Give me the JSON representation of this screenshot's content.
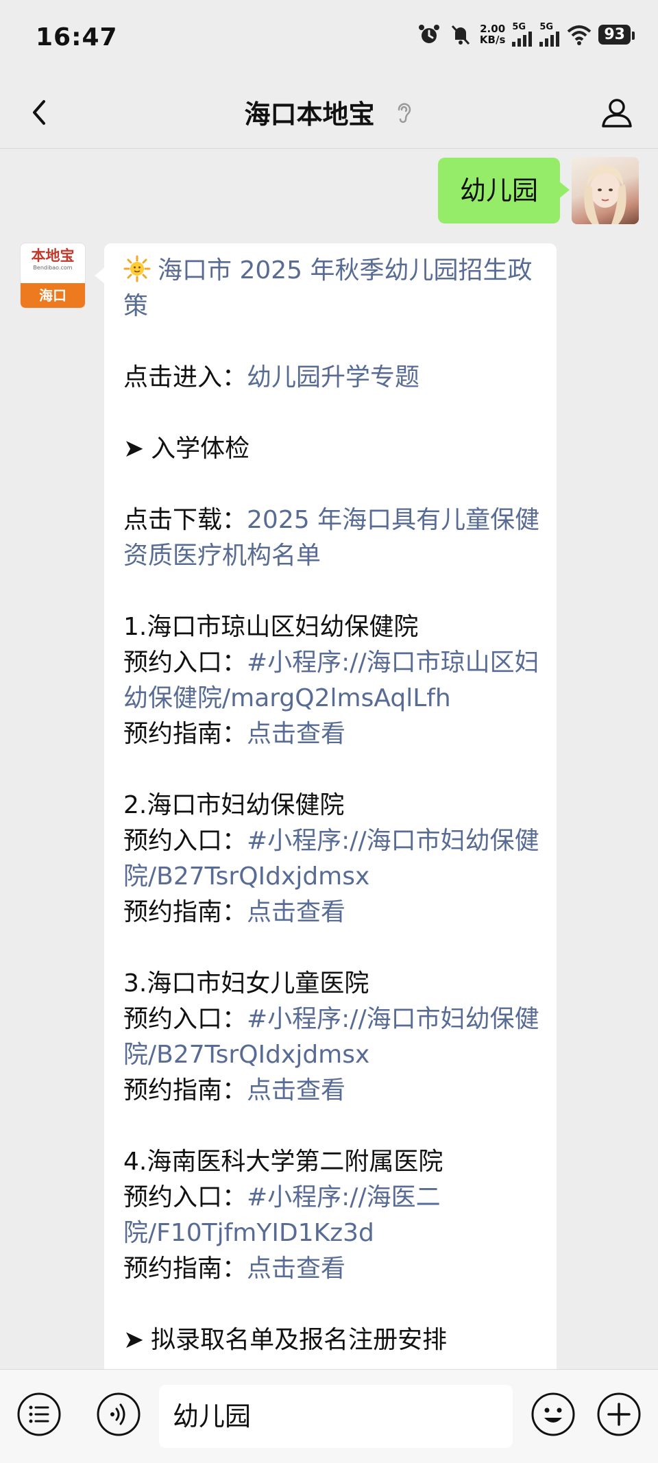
{
  "status_bar": {
    "time": "16:47",
    "net_speed_value": "2.00",
    "net_speed_unit": "KB/s",
    "sim1_label": "5G",
    "sim2_label": "5G",
    "battery": "93",
    "icons": [
      "alarm-icon",
      "mute-bell-icon",
      "signal-icon",
      "signal-icon",
      "wifi-icon",
      "battery-icon"
    ]
  },
  "nav": {
    "title": "海口本地宝",
    "icons": [
      "back-icon",
      "ear-icon",
      "profile-icon"
    ]
  },
  "chat": {
    "my_message": "幼儿园",
    "bot_avatar": {
      "logo_text": "本地宝",
      "logo_sub": "Bendibao.com",
      "city": "海口"
    },
    "bot_message": {
      "title": "海口市 2025 年秋季幼儿园招生政策",
      "enter_label": "点击进入：",
      "enter_link": "幼儿园升学专题",
      "section1": "入学体检",
      "download_label": "点击下载：",
      "download_link": "2025 年海口具有儿童保健资质医疗机构名单",
      "hospitals": [
        {
          "name": "1.海口市琼山区妇幼保健院",
          "entry_label": "预约入口：",
          "entry_link": "#小程序://海口市琼山区妇幼保健院/margQ2lmsAqlLfh",
          "guide_label": "预约指南：",
          "guide_link": "点击查看"
        },
        {
          "name": "2.海口市妇幼保健院",
          "entry_label": "预约入口：",
          "entry_link": "#小程序://海口市妇幼保健院/B27TsrQIdxjdmsx",
          "guide_label": "预约指南：",
          "guide_link": "点击查看"
        },
        {
          "name": "3.海口市妇女儿童医院",
          "entry_label": "预约入口：",
          "entry_link": "#小程序://海口市妇幼保健院/B27TsrQIdxjdmsx",
          "guide_label": "预约指南：",
          "guide_link": "点击查看"
        },
        {
          "name": "4.海南医科大学第二附属医院",
          "entry_label": "预约入口：",
          "entry_link": "#小程序://海医二院/F10TjfmYID1Kz3d",
          "guide_label": "预约指南：",
          "guide_link": "点击查看"
        }
      ],
      "section2": "拟录取名单及报名注册安排"
    }
  },
  "input_bar": {
    "value": "幼儿园",
    "icons": [
      "menu-list-icon",
      "voice-icon",
      "emoji-icon",
      "plus-icon"
    ]
  },
  "colors": {
    "background": "#ededed",
    "my_bubble": "#95ec69",
    "link": "#576b95",
    "brand_orange": "#ee7a1f"
  }
}
